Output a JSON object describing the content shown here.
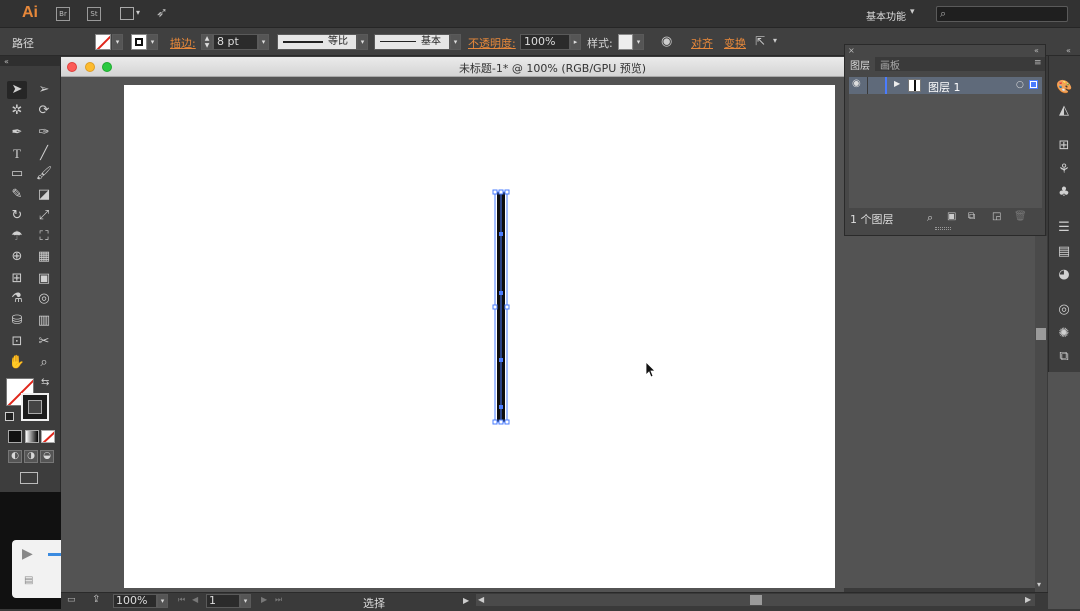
{
  "app": {
    "logo": "Ai",
    "icon_br": "Br",
    "icon_st": "St",
    "workspace": "基本功能",
    "search_placeholder": ""
  },
  "control_bar": {
    "selection_type": "路径",
    "stroke_label": "描边:",
    "stroke_value": "8 pt",
    "profile_label": "等比",
    "brush_label": "基本",
    "opacity_label": "不透明度:",
    "opacity_value": "100%",
    "style_label": "样式:",
    "align_label": "对齐",
    "transform_label": "变换"
  },
  "document": {
    "title": "未标题-1* @ 100% (RGB/GPU 预览)"
  },
  "layers_panel": {
    "tabs": [
      "图层",
      "画板"
    ],
    "layer_name": "图层 1",
    "count": "1 个图层"
  },
  "status_bar": {
    "zoom": "100%",
    "page": "1",
    "tool_status": "选择"
  },
  "colors": {
    "accent": "#e7883a",
    "selection": "#4a7cff"
  },
  "icons": {
    "tools": [
      "selection-icon",
      "direct-selection-icon",
      "magic-wand-icon",
      "lasso-icon",
      "pen-icon",
      "curvature-icon",
      "type-icon",
      "line-icon",
      "rectangle-icon",
      "paintbrush-icon",
      "pencil-icon",
      "eraser-icon",
      "rotate-icon",
      "scale-icon",
      "warp-icon",
      "free-transform-icon",
      "shape-builder-icon",
      "perspective-icon",
      "mesh-icon",
      "gradient-icon",
      "eyedropper-icon",
      "blend-icon",
      "symbol-sprayer-icon",
      "column-graph-icon",
      "artboard-icon",
      "slice-icon",
      "hand-icon",
      "zoom-icon"
    ]
  }
}
